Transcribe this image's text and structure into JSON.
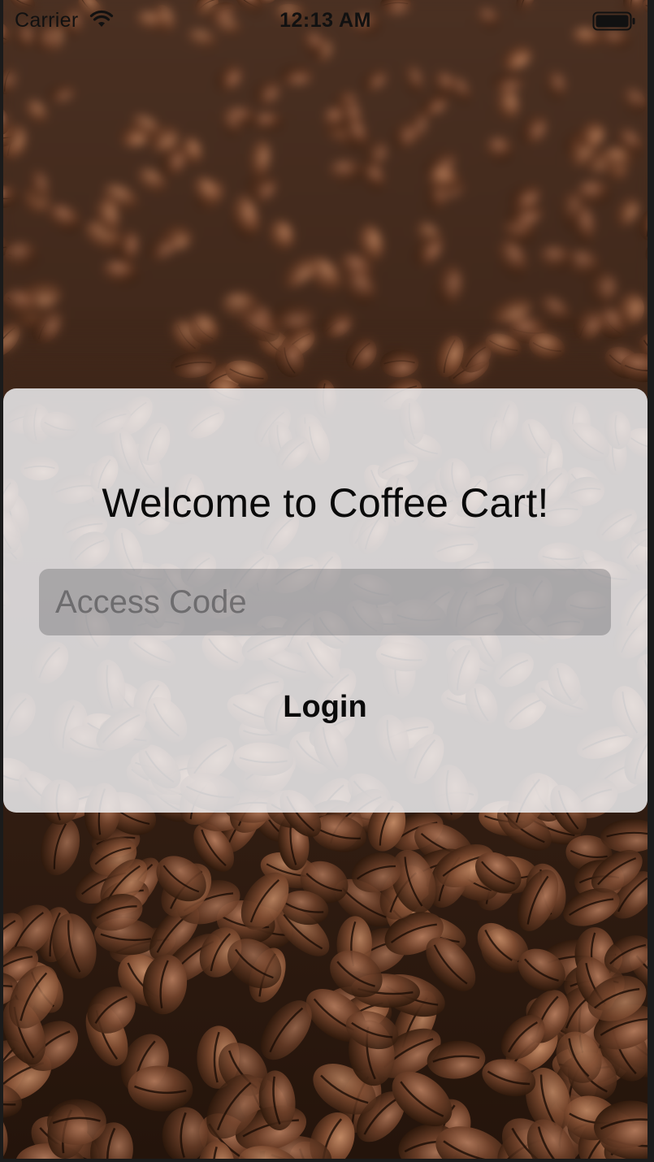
{
  "status_bar": {
    "carrier": "Carrier",
    "time": "12:13 AM",
    "wifi_icon": "wifi-icon",
    "battery_icon": "battery-full-icon"
  },
  "background": {
    "description_icon": "coffee-beans-photo",
    "colors": {
      "dark": "#2a1810",
      "mid": "#5a3422",
      "light": "#a0684a"
    }
  },
  "login_card": {
    "title": "Welcome to Coffee Cart!",
    "access_code": {
      "placeholder": "Access Code",
      "value": ""
    },
    "login_label": "Login"
  }
}
